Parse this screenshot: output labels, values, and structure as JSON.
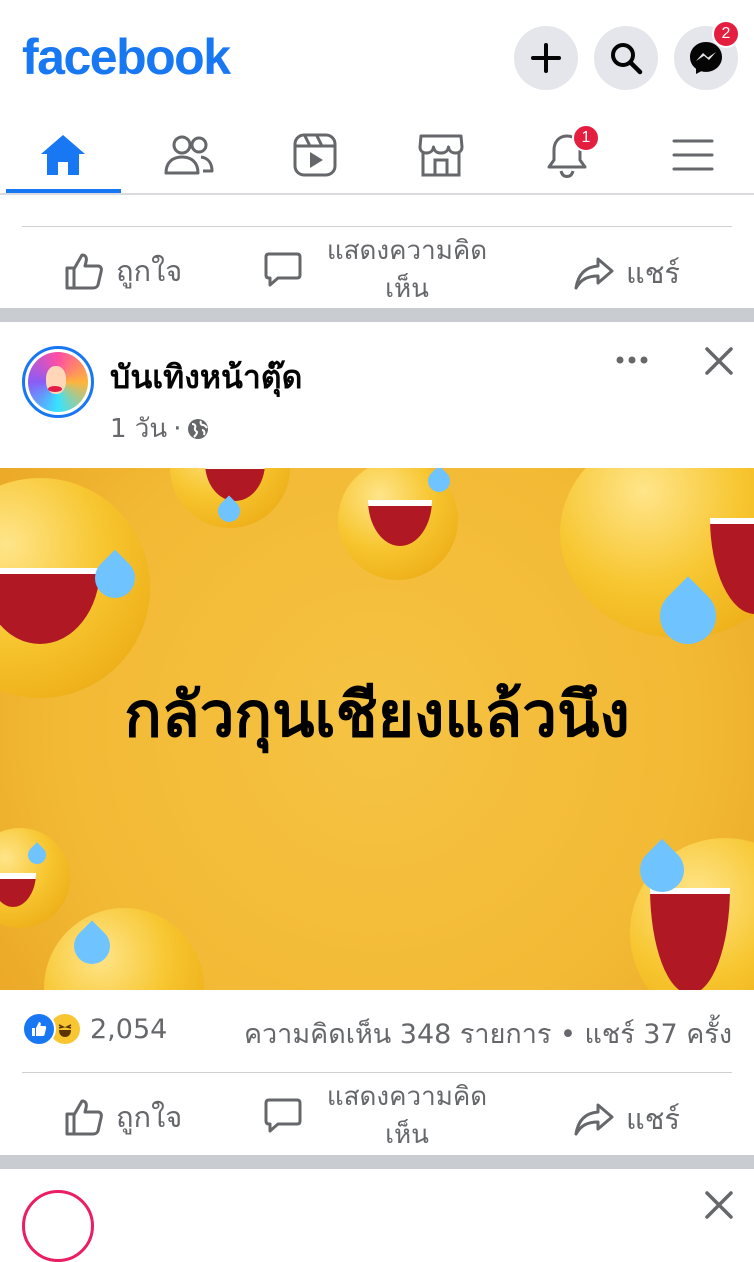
{
  "header": {
    "logo": "facebook",
    "messenger_badge": "2"
  },
  "nav": {
    "notifications_badge": "1"
  },
  "prev_post": {
    "like_label": "ถูกใจ",
    "comment_label": "แสดงความคิดเห็น",
    "share_label": "แชร์"
  },
  "post": {
    "page_name": "บันเทิงหน้าตุ๊ด",
    "time": "1 วัน",
    "dot": "·",
    "image_text": "กลัวกุนเชียงแล้วนึง",
    "reaction_count": "2,054",
    "comments_shares": "ความคิดเห็น 348 รายการ • แชร์ 37 ครั้ง",
    "like_label": "ถูกใจ",
    "comment_label": "แสดงความคิดเห็น",
    "share_label": "แชร์"
  },
  "colors": {
    "brand": "#1877f2",
    "badge": "#e41e3f",
    "image_bg": "#f2b934"
  }
}
